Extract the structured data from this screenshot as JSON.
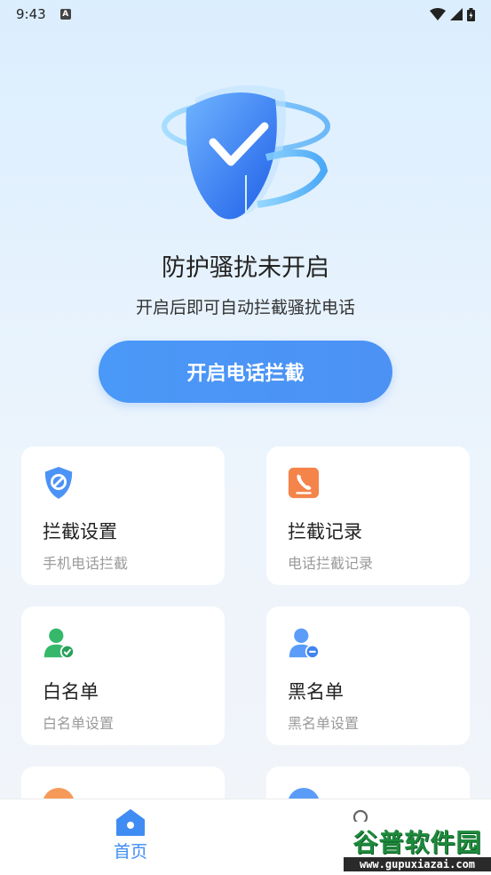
{
  "status_bar": {
    "time": "9:43",
    "notif_badge": "A"
  },
  "hero": {
    "title": "防护骚扰未开启",
    "subtitle": "开启后即可自动拦截骚扰电话",
    "cta_label": "开启电话拦截"
  },
  "cards": [
    {
      "name": "拦截设置",
      "desc": "手机电话拦截",
      "icon": "shield-block-icon"
    },
    {
      "name": "拦截记录",
      "desc": "电话拦截记录",
      "icon": "phone-record-icon"
    },
    {
      "name": "白名单",
      "desc": "白名单设置",
      "icon": "user-check-icon"
    },
    {
      "name": "黑名单",
      "desc": "黑名单设置",
      "icon": "user-minus-icon"
    }
  ],
  "bottom_nav": {
    "home_label": "首页"
  },
  "watermark": {
    "brand": "谷普软件园",
    "url": "www.gupuxiazai.com"
  },
  "colors": {
    "accent": "#4a98f7",
    "green": "#35b86a",
    "orange": "#f4844a"
  }
}
